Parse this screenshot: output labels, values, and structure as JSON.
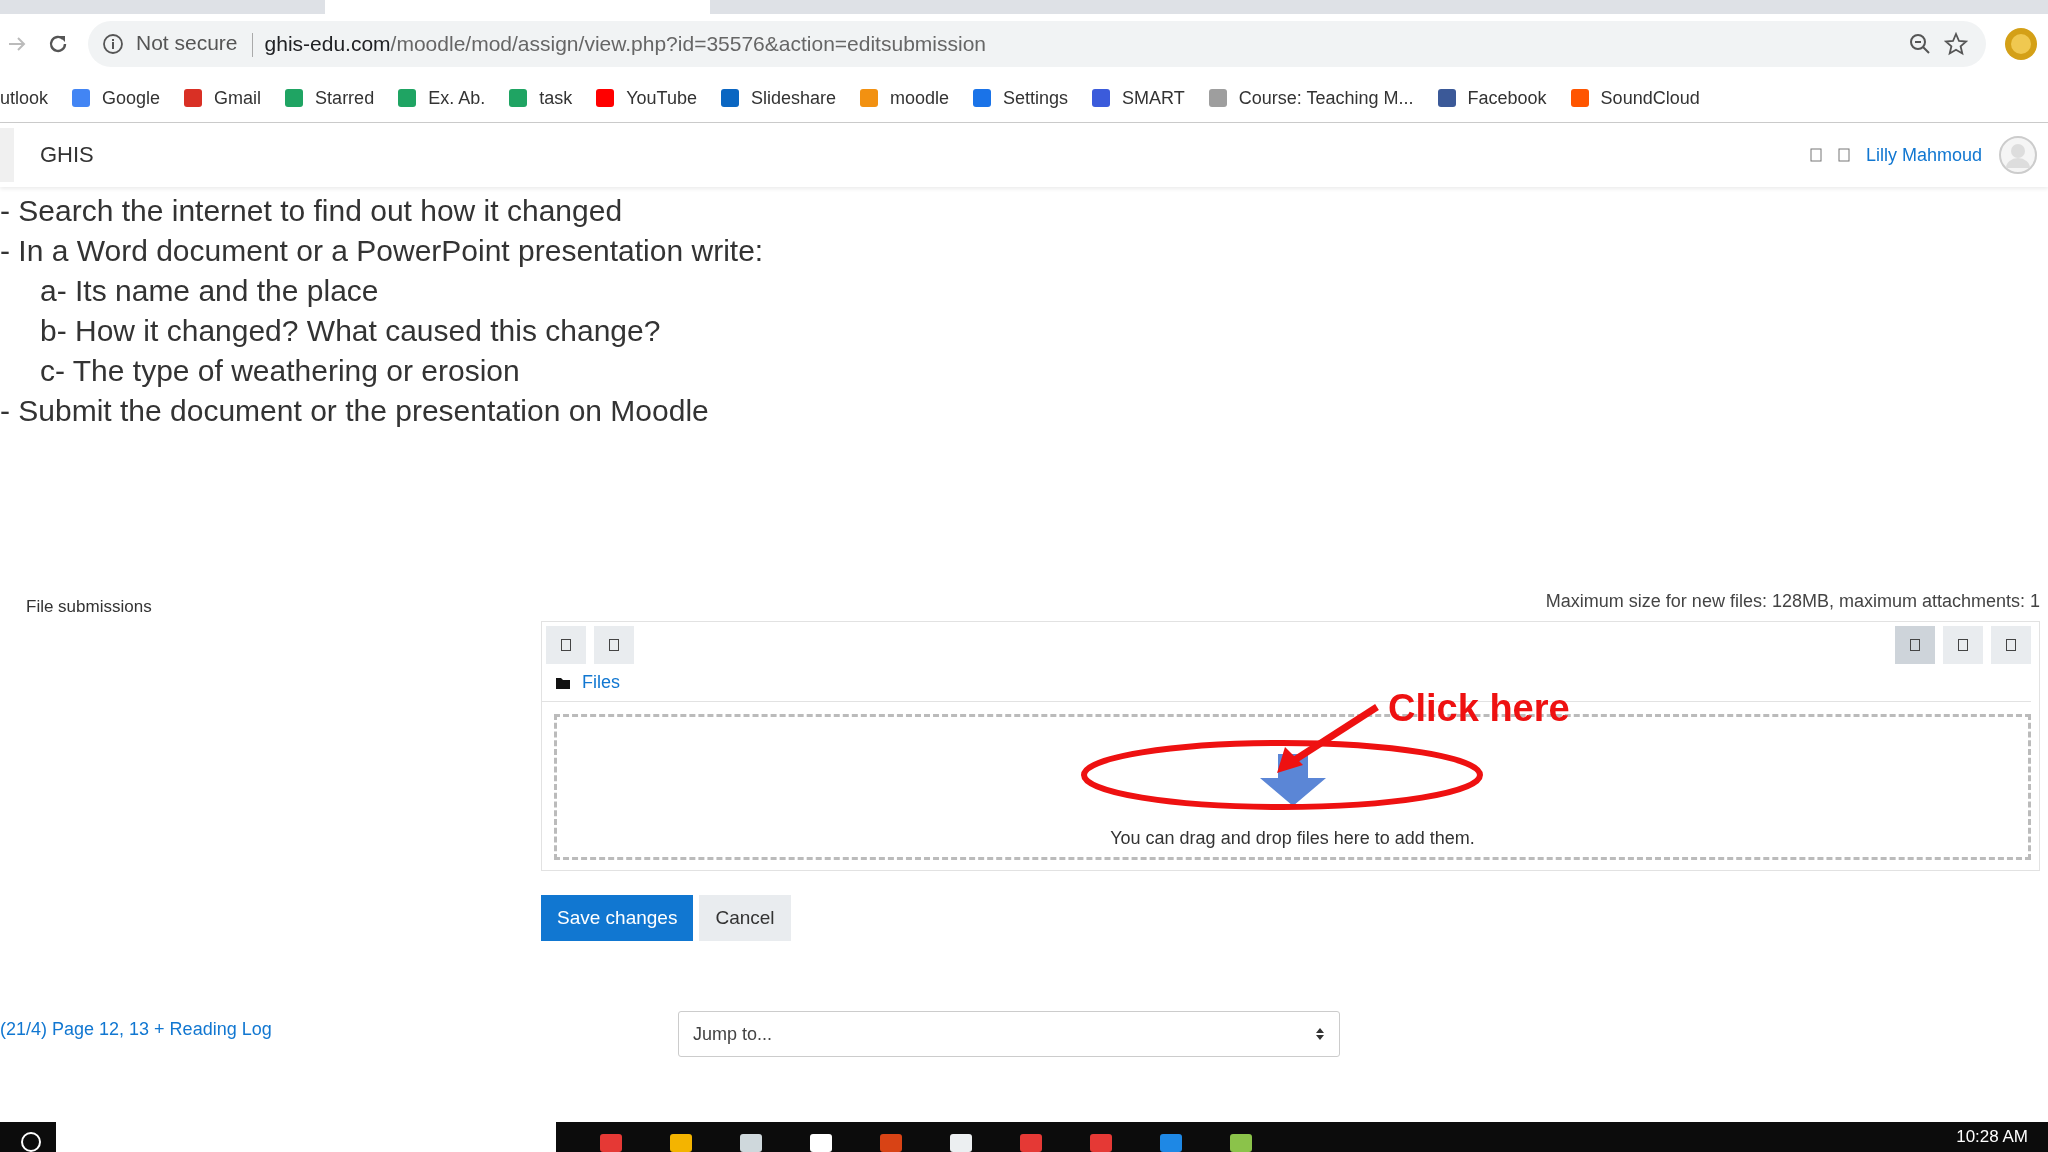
{
  "browser": {
    "address": {
      "security": "Not secure",
      "host": "ghis-edu.com",
      "path": "/moodle/mod/assign/view.php?id=35576&action=editsubmission"
    },
    "bookmarks": [
      {
        "label": "utlook",
        "kind": "none"
      },
      {
        "label": "Google",
        "kind": "g"
      },
      {
        "label": "Gmail",
        "kind": "mail"
      },
      {
        "label": "Starred",
        "kind": "drive"
      },
      {
        "label": "Ex. Ab.",
        "kind": "drive"
      },
      {
        "label": "task",
        "kind": "drive"
      },
      {
        "label": "YouTube",
        "kind": "play"
      },
      {
        "label": "Slideshare",
        "kind": "in"
      },
      {
        "label": "moodle",
        "kind": "cap"
      },
      {
        "label": "Settings",
        "kind": "gear"
      },
      {
        "label": "SMART",
        "kind": "smart"
      },
      {
        "label": "Course: Teaching M...",
        "kind": "doc"
      },
      {
        "label": "Facebook",
        "kind": "f"
      },
      {
        "label": "SoundCloud",
        "kind": "cloud"
      }
    ]
  },
  "header": {
    "site": "GHIS",
    "user": "Lilly Mahmoud"
  },
  "instructions": [
    {
      "text": "- Search the internet to find out how it changed"
    },
    {
      "text": "- In a Word document or a PowerPoint presentation write:",
      "children": [
        {
          "text": "a- Its name and the place"
        },
        {
          "text": "b- How it changed? What caused this change?"
        },
        {
          "text": "c- The type of weathering or erosion"
        }
      ]
    },
    {
      "text": "- Submit the document or the presentation on Moodle"
    }
  ],
  "file_submissions": {
    "label": "File submissions",
    "limits": "Maximum size for new files: 128MB, maximum attachments: 1",
    "folder": "Files",
    "dropzone": "You can drag and drop files here to add them.",
    "view_modes": [
      {
        "selected": true
      },
      {
        "selected": false
      },
      {
        "selected": false
      }
    ]
  },
  "buttons": [
    {
      "label": "Save changes",
      "kind": "primary"
    },
    {
      "label": "Cancel",
      "kind": "secondary"
    }
  ],
  "footer": {
    "previous": "(21/4) Page 12, 13 + Reading Log",
    "jump": "Jump to..."
  },
  "annotation": {
    "text": "Click here"
  },
  "taskbar": {
    "clock": "10:28 AM"
  }
}
